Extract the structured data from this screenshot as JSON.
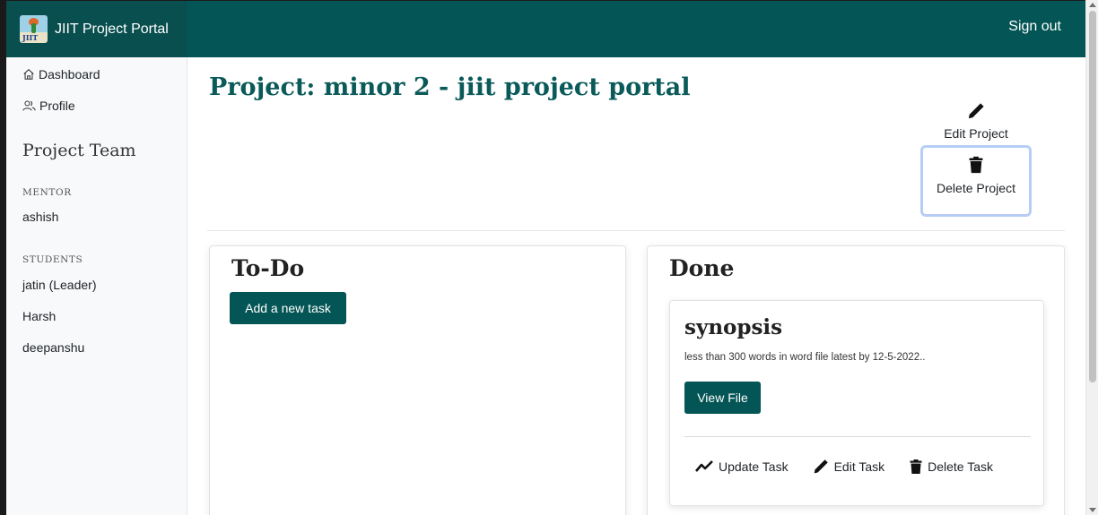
{
  "header": {
    "brand_title": "JIIT Project Portal",
    "logo_text": "JIIT",
    "signout_label": "Sign out"
  },
  "sidebar": {
    "nav": [
      {
        "label": "Dashboard",
        "icon": "home-icon"
      },
      {
        "label": "Profile",
        "icon": "users-icon"
      }
    ],
    "team_title": "Project Team",
    "mentor_label": "MENTOR",
    "mentor": "ashish",
    "students_label": "STUDENTS",
    "students": [
      "jatin (Leader)",
      "Harsh",
      "deepanshu"
    ]
  },
  "project": {
    "prefix": "Project: ",
    "name": "minor 2",
    "separator": " - ",
    "subtitle": "jiit project portal",
    "edit_label": "Edit Project",
    "delete_label": "Delete Project"
  },
  "todo": {
    "title": "To-Do",
    "add_label": "Add a new task"
  },
  "done": {
    "title": "Done",
    "task": {
      "title": "synopsis",
      "description": "less than 300 words in word file latest by 12-5-2022..",
      "view_label": "View File",
      "update_label": "Update Task",
      "edit_label": "Edit Task",
      "delete_label": "Delete Task"
    }
  },
  "colors": {
    "header": "#045555",
    "accent_button": "#045555",
    "title_text": "#0b5a5a",
    "delete_focus_border": "#b7cdf5"
  }
}
